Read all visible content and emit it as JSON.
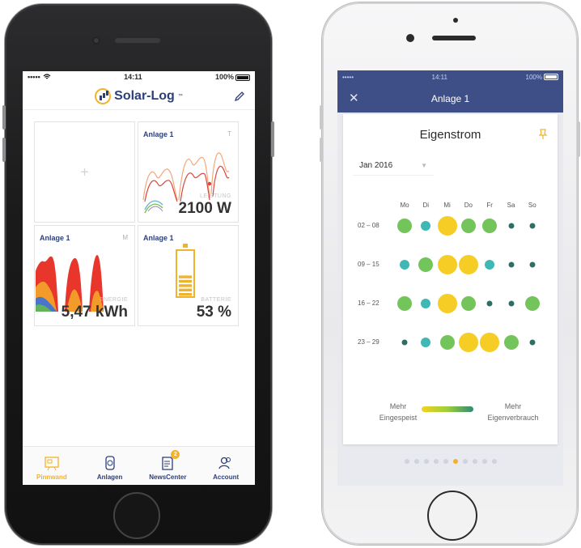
{
  "left": {
    "status": {
      "carrier": "•••••",
      "time": "14:11",
      "battery": "100%"
    },
    "logo_text": "Solar-Log",
    "tiles": [
      {
        "id": "empty",
        "icon": "plus-icon"
      },
      {
        "title": "Anlage 1",
        "range": "T",
        "label": "LEISTUNG",
        "value": "2100 W"
      },
      {
        "title": "Anlage 1",
        "range": "M",
        "label": "ENERGIE",
        "value": "5,47 kWh"
      },
      {
        "title": "Anlage 1",
        "range": "",
        "label": "BATTERIE",
        "value": "53 %",
        "battery_level": 0.53
      }
    ],
    "tabs": [
      {
        "label": "Pinnwand",
        "icon": "pinboard-icon",
        "active": true
      },
      {
        "label": "Anlagen",
        "icon": "plant-icon",
        "active": false
      },
      {
        "label": "NewsCenter",
        "icon": "news-icon",
        "active": false,
        "badge": "2"
      },
      {
        "label": "Account",
        "icon": "account-icon",
        "active": false
      }
    ]
  },
  "right": {
    "status": {
      "carrier": "•••••",
      "time": "14:11",
      "battery": "100%"
    },
    "header_title": "Anlage 1",
    "card_title": "Eigenstrom",
    "month": "Jan 2016",
    "days": [
      "Mo",
      "Di",
      "Mi",
      "Do",
      "Fr",
      "Sa",
      "So"
    ],
    "weeks": [
      {
        "label": "02 – 08",
        "cells": [
          [
            "green",
            "m"
          ],
          [
            "teal",
            "s"
          ],
          [
            "yellow",
            "l"
          ],
          [
            "green",
            "m"
          ],
          [
            "green",
            "m"
          ],
          [
            "dark",
            "xs"
          ],
          [
            "dark",
            "xs"
          ]
        ]
      },
      {
        "label": "09 – 15",
        "cells": [
          [
            "teal",
            "s"
          ],
          [
            "green",
            "m"
          ],
          [
            "yellow",
            "l"
          ],
          [
            "yellow",
            "l"
          ],
          [
            "teal",
            "s"
          ],
          [
            "dark",
            "xs"
          ],
          [
            "dark",
            "xs"
          ]
        ]
      },
      {
        "label": "16 – 22",
        "cells": [
          [
            "green",
            "m"
          ],
          [
            "teal",
            "s"
          ],
          [
            "yellow",
            "l"
          ],
          [
            "green",
            "m"
          ],
          [
            "dark",
            "xs"
          ],
          [
            "dark",
            "xs"
          ],
          [
            "green",
            "m"
          ]
        ]
      },
      {
        "label": "23 – 29",
        "cells": [
          [
            "dark",
            "xs"
          ],
          [
            "teal",
            "s"
          ],
          [
            "green",
            "m"
          ],
          [
            "yellow",
            "l"
          ],
          [
            "yellow",
            "l"
          ],
          [
            "green",
            "m"
          ],
          [
            "dark",
            "xs"
          ]
        ]
      }
    ],
    "legend_left": "Mehr\nEingespeist",
    "legend_right": "Mehr\nEigenverbrauch",
    "page_count": 10,
    "page_active": 5,
    "colors": {
      "yellow": "#f6cd24",
      "green": "#74c45c",
      "teal": "#3fb8b5",
      "dark": "#2f6f61",
      "accent": "#f0b32b",
      "header": "#3e4f88"
    }
  }
}
